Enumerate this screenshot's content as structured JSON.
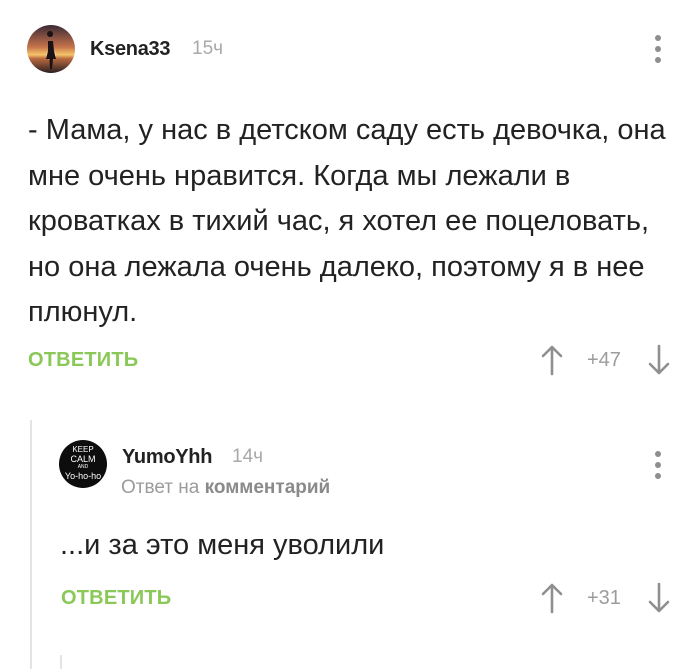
{
  "comments": [
    {
      "author": "Ksena33",
      "time": "15ч",
      "text": "- Мама, у нас в детском саду есть девочка, она мне очень нравится. Когда мы лежали в кроватках в тихий час, я хотел ее поцеловать, но она лежала очень далеко, поэтому я в нее плюнул.",
      "reply_label": "ОТВЕТИТЬ",
      "score": "+47"
    },
    {
      "author": "YumoYhh",
      "time": "14ч",
      "reply_to_prefix": "Ответ на",
      "reply_to_target": "комментарий",
      "avatar_text": [
        "KEEP",
        "CALM",
        "AND",
        "Yo-ho-ho"
      ],
      "text": "...и за это меня уволили",
      "reply_label": "ОТВЕТИТЬ",
      "score": "+31"
    }
  ],
  "icons": {
    "upvote": "arrow-up-icon",
    "downvote": "arrow-down-icon",
    "menu": "more-vertical-icon"
  },
  "colors": {
    "reply_green": "#8ac858",
    "muted": "#9c9c9c"
  }
}
